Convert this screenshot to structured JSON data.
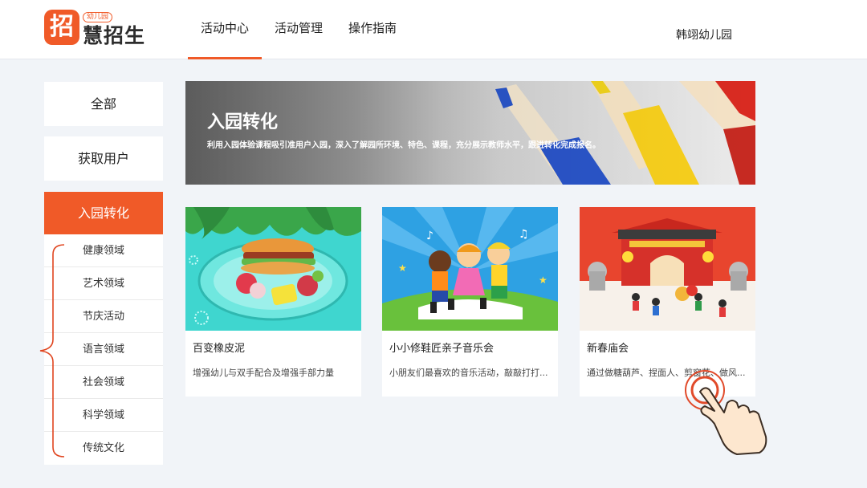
{
  "header": {
    "logo_mark": "招",
    "logo_badge": "幼儿园",
    "logo_text_a": "慧",
    "logo_text_b": "招生",
    "nav": [
      "活动中心",
      "活动管理",
      "操作指南"
    ],
    "user": "韩翊幼儿园"
  },
  "sidebar": {
    "items": [
      "全部",
      "获取用户",
      "入园转化"
    ],
    "active": "入园转化",
    "sub_items": [
      "健康领域",
      "艺术领域",
      "节庆活动",
      "语言领域",
      "社会领域",
      "科学领域",
      "传统文化"
    ]
  },
  "banner": {
    "title": "入园转化",
    "desc": "利用入园体验课程吸引准用户入园，深入了解园所环境、特色、课程，充分展示教师水平，跟进转化完成报名。"
  },
  "cards": [
    {
      "title": "百变橡皮泥",
      "desc": "增强幼儿与双手配合及增强手部力量"
    },
    {
      "title": "小小修鞋匠亲子音乐会",
      "desc": "小朋友们最喜欢的音乐活动，敲敲打打..."
    },
    {
      "title": "新春庙会",
      "desc": "通过做糖葫芦、捏面人、剪窗花、做风..."
    }
  ],
  "colors": {
    "accent": "#f05a28",
    "page_bg": "#f1f4f8"
  }
}
